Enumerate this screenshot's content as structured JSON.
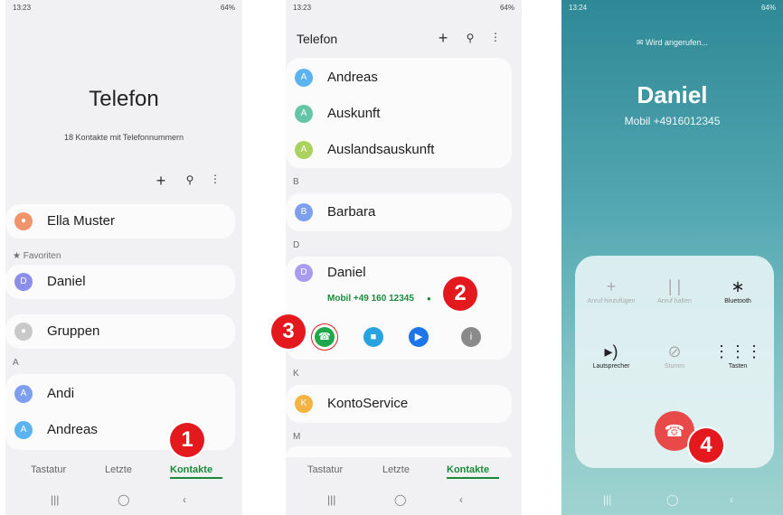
{
  "phone1": {
    "status_time": "13:23",
    "status_right": "64%",
    "title": "Telefon",
    "subtitle": "18 Kontakte mit Telefonnummern",
    "toolbar": {
      "add_icon": "plus-icon",
      "search_icon": "search-icon",
      "more_icon": "more-vert-icon"
    },
    "profile_name": "Ella Muster",
    "favorites_label": "Favoriten",
    "favorite": {
      "initial": "D",
      "name": "Daniel"
    },
    "groups_label": "Gruppen",
    "section_a": "A",
    "contacts": [
      {
        "initial": "A",
        "name": "Andi"
      },
      {
        "initial": "A",
        "name": "Andreas"
      }
    ],
    "tabs": [
      "Tastatur",
      "Letzte",
      "Kontakte"
    ],
    "active_tab": "Kontakte",
    "badge": "1"
  },
  "phone2": {
    "status_time": "13:23",
    "status_right": "64%",
    "title": "Telefon",
    "contacts_a": [
      {
        "initial": "A",
        "name": "Andreas"
      },
      {
        "initial": "A",
        "name": "Auskunft"
      },
      {
        "initial": "A",
        "name": "Auslandsauskunft"
      }
    ],
    "section_b": "B",
    "contact_b": {
      "initial": "B",
      "name": "Barbara"
    },
    "section_d": "D",
    "contact_d": {
      "initial": "D",
      "name": "Daniel",
      "number": "Mobil +49 160 12345"
    },
    "section_k": "K",
    "contact_k": {
      "initial": "K",
      "name": "KontoService"
    },
    "section_m": "M",
    "tabs": [
      "Tastatur",
      "Letzte",
      "Kontakte"
    ],
    "active_tab": "Kontakte",
    "badge2": "2",
    "badge3": "3",
    "colors": {
      "call": "#1ea84a",
      "message": "#27a3e0",
      "video": "#1c76e8",
      "info": "#8a8a8a"
    }
  },
  "phone3": {
    "status_time": "13:24",
    "status_right": "64%",
    "calling_label": "Wird angerufen...",
    "caller_name": "Daniel",
    "caller_number": "Mobil +4916012345",
    "buttons": [
      {
        "icon": "plus-icon",
        "label": "Anruf hinzufügen"
      },
      {
        "icon": "pause-icon",
        "label": "Anruf halten"
      },
      {
        "icon": "bluetooth-icon",
        "label": "Bluetooth"
      },
      {
        "icon": "speaker-icon",
        "label": "Lautsprecher"
      },
      {
        "icon": "mic-off-icon",
        "label": "Stumm"
      },
      {
        "icon": "keypad-icon",
        "label": "Tasten"
      }
    ],
    "badge": "4",
    "end_call_color": "#e84a4a"
  }
}
